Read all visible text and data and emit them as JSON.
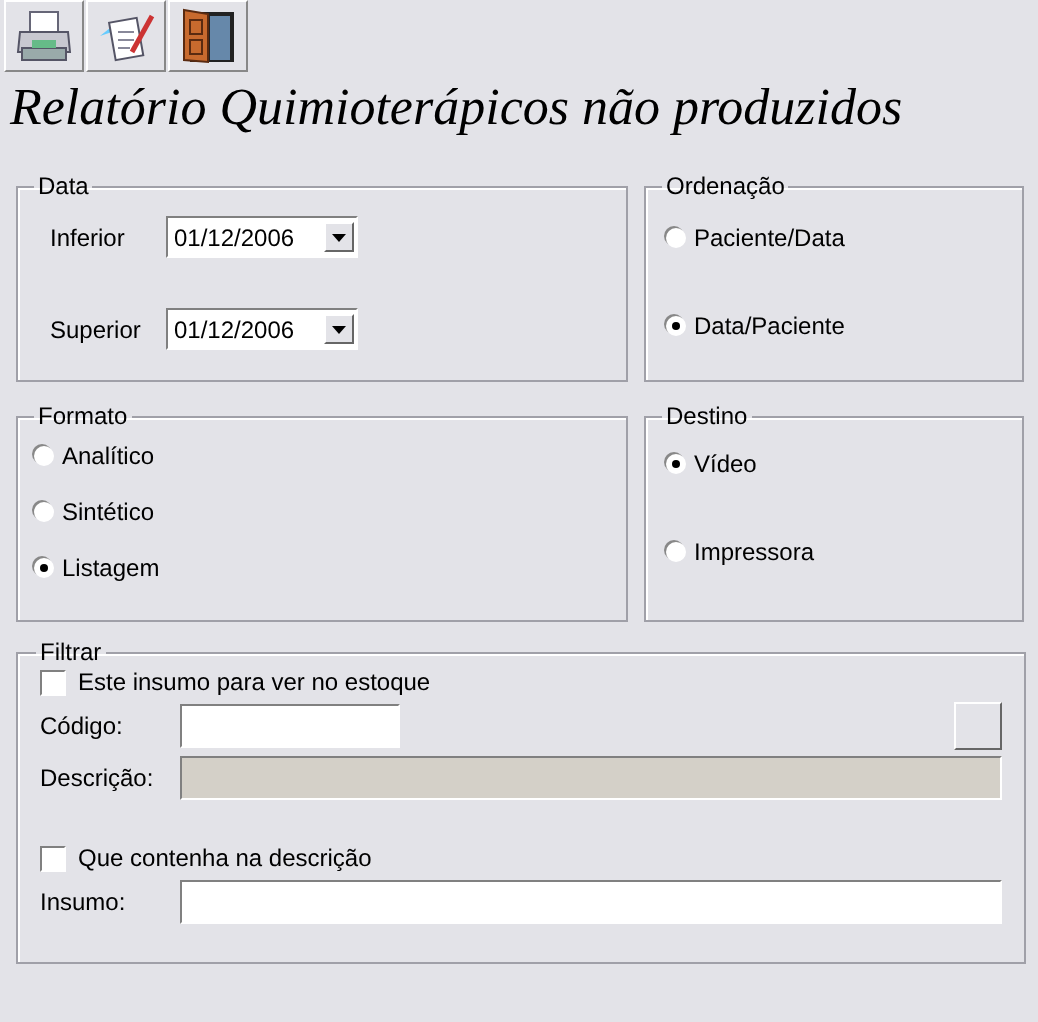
{
  "toolbar": [
    {
      "kind": "printer"
    },
    {
      "kind": "notepad"
    },
    {
      "kind": "door"
    }
  ],
  "title": "Relatório Quimioterápicos não produzidos",
  "data": {
    "label": "Data",
    "fields": [
      {
        "label": "Inferior",
        "value": "01/12/2006"
      },
      {
        "label": "Superior",
        "value": "01/12/2006"
      }
    ]
  },
  "ordenacao": {
    "label": "Ordenação",
    "options": [
      {
        "label": "Paciente/Data",
        "selected": false
      },
      {
        "label": "Data/Paciente",
        "selected": true
      }
    ]
  },
  "formato": {
    "label": "Formato",
    "options": [
      {
        "label": "Analítico",
        "selected": false
      },
      {
        "label": "Sintético",
        "selected": false
      },
      {
        "label": "Listagem",
        "selected": true
      }
    ]
  },
  "destino": {
    "label": "Destino",
    "options": [
      {
        "label": "Vídeo",
        "selected": true
      },
      {
        "label": "Impressora",
        "selected": false
      }
    ]
  },
  "filtrar": {
    "label": "Filtrar",
    "stock_check": {
      "label": "Este insumo para ver no estoque",
      "checked": false
    },
    "codigo": {
      "label": "Código:"
    },
    "descricao": {
      "label": "Descrição:",
      "disabled": true
    },
    "contains_check": {
      "label": "Que contenha na descrição",
      "checked": false
    },
    "insumo": {
      "label": "Insumo:"
    }
  }
}
